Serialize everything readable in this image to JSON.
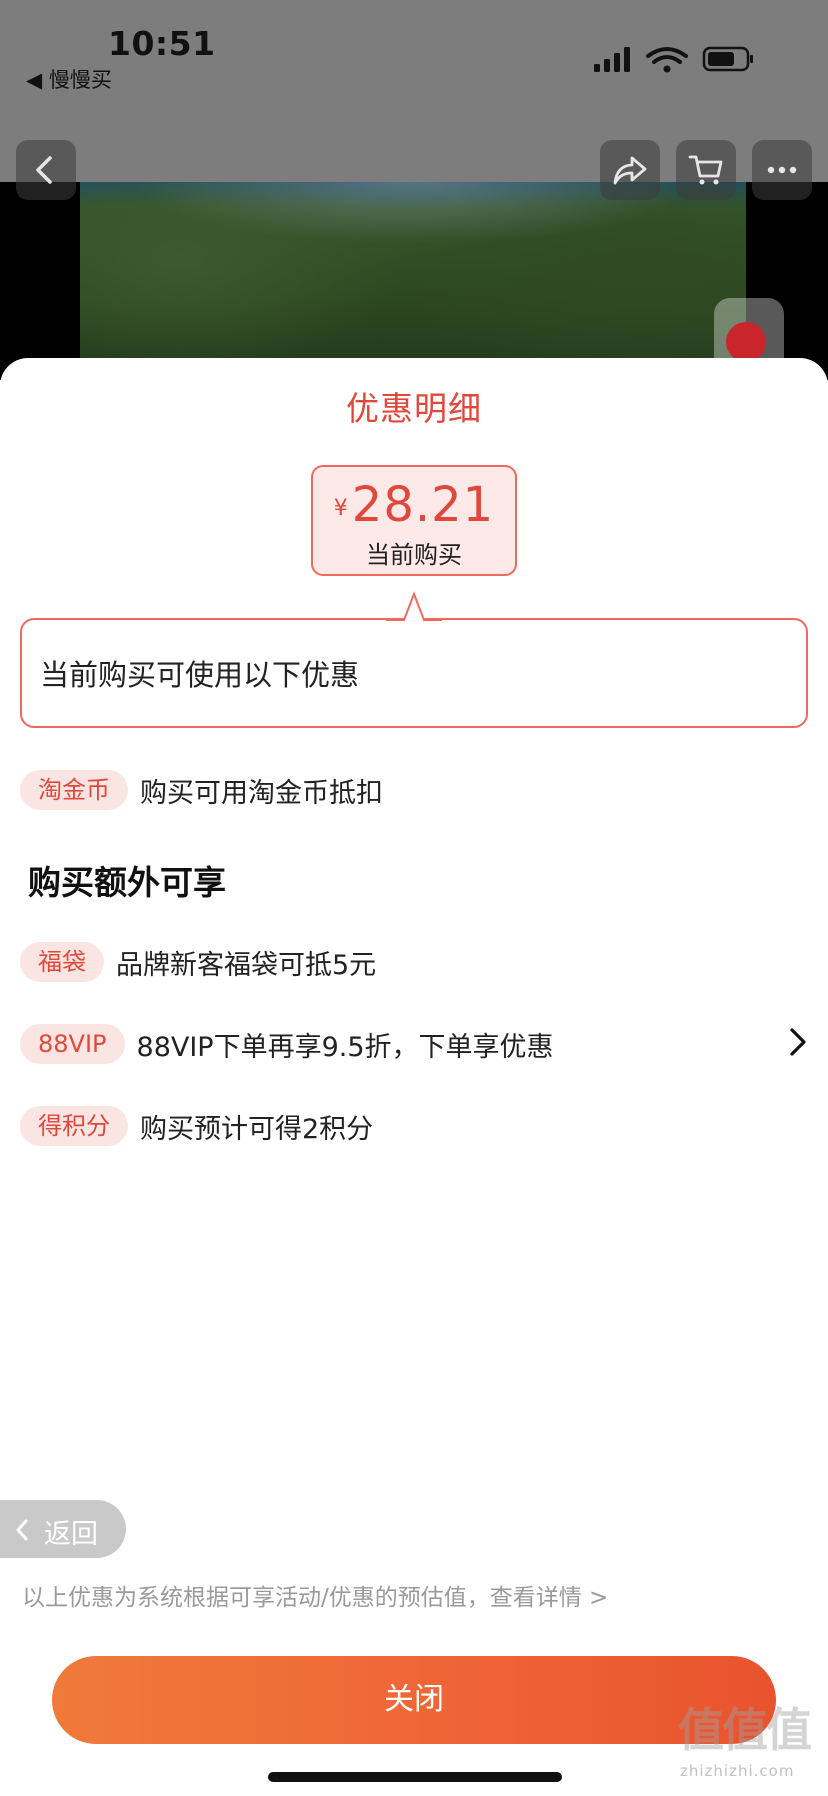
{
  "status_bar": {
    "time": "10:51",
    "back_app": "◀ 慢慢买"
  },
  "sheet": {
    "title": "优惠明细",
    "price": {
      "currency": "¥",
      "amount": "28.21",
      "caption": "当前购买"
    },
    "tip": "当前购买可使用以下优惠",
    "coupons": [
      {
        "tag": "淘金币",
        "text": "购买可用淘金币抵扣"
      }
    ],
    "extra_section_title": "购买额外可享",
    "extras": [
      {
        "tag": "福袋",
        "text": "品牌新客福袋可抵5元"
      },
      {
        "tag": "88VIP",
        "text": "88VIP下单再享9.5折，下单享优惠"
      },
      {
        "tag": "得积分",
        "text": "购买预计可得2积分"
      }
    ],
    "back_label": "返回",
    "disclaimer": "以上优惠为系统根据可享活动/优惠的预估值，查看详情 >",
    "close_label": "关闭"
  },
  "watermark": {
    "brand": "值值值",
    "domain": "zhizhizhi.com"
  },
  "colors": {
    "accent": "#e0483c",
    "pill_bg": "#fbe5e3",
    "button_start": "#f07a3a",
    "button_end": "#e8532e"
  }
}
